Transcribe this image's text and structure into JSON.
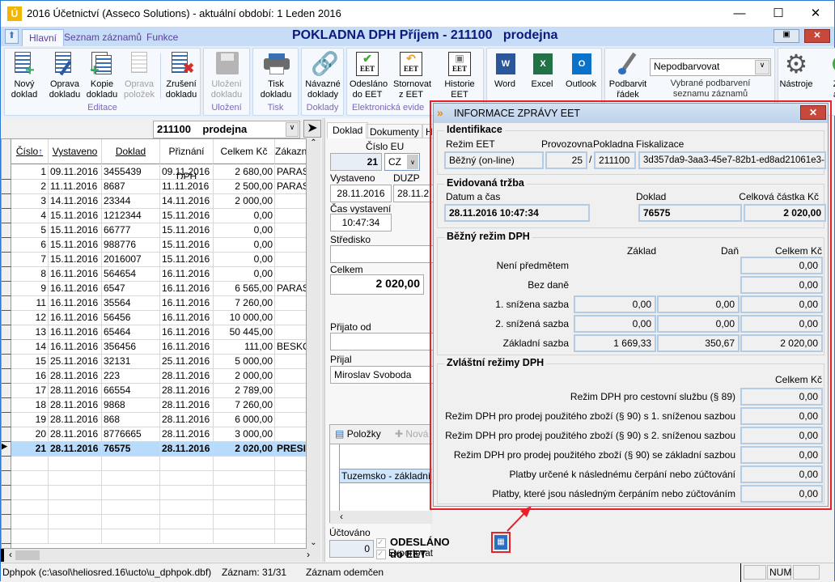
{
  "window": {
    "title": "2016 Účetnictví  (Asseco Solutions)  -  aktuální období:  1  Leden 2016",
    "app_icon_letter": "Ú"
  },
  "ribbon_tabs": [
    "Hlavní",
    "Seznam záznamů",
    "Funkce"
  ],
  "module_title": "POKLADNA DPH Příjem - 211100   prodejna",
  "ribbon": {
    "groups": [
      "Editace",
      "Uložení",
      "Tisk",
      "Doklady",
      "Elektronická evide"
    ],
    "buttons": {
      "novy": [
        "Nový",
        "doklad"
      ],
      "oprava": [
        "Oprava",
        "dokladu"
      ],
      "kopie": [
        "Kopie",
        "dokladu"
      ],
      "oprava_pol": [
        "Oprava",
        "položek"
      ],
      "zruseni": [
        "Zrušení",
        "dokladu"
      ],
      "ulozeni": [
        "Uložení",
        "dokladu"
      ],
      "tisk": [
        "Tisk",
        "dokladu"
      ],
      "navazne": [
        "Návazné",
        "doklady"
      ],
      "odeslano": [
        "Odesláno",
        "do EET"
      ],
      "stornovat": [
        "Stornovat",
        "z EET"
      ],
      "historie": [
        "Historie",
        "EET"
      ],
      "word": "Word",
      "excel": "Excel",
      "outlook": "Outlook",
      "podbarvit": [
        "Podbarvit",
        "řádek"
      ],
      "nastroje": "Nástroje",
      "zo": [
        "Zo",
        "ad"
      ]
    },
    "eet_badge": "EET",
    "color_select": {
      "value": "Nepodbarvovat",
      "caption": [
        "Vybrané podbarvení",
        "seznamu záznamů"
      ]
    }
  },
  "list": {
    "combo_value": "211100    prodejna",
    "columns": [
      "Číslo",
      "Vystaveno",
      "Doklad",
      "Přiznání DPH",
      "Celkem Kč",
      "Zákazní"
    ],
    "rows": [
      [
        "1",
        "09.11.2016",
        "3455439",
        "09.11.2016",
        "2 680,00",
        "PARAS"
      ],
      [
        "2",
        "11.11.2016",
        "8687",
        "11.11.2016",
        "2 500,00",
        "PARAS"
      ],
      [
        "3",
        "14.11.2016",
        "23344",
        "14.11.2016",
        "2 000,00",
        ""
      ],
      [
        "4",
        "15.11.2016",
        "1212344",
        "15.11.2016",
        "0,00",
        ""
      ],
      [
        "5",
        "15.11.2016",
        "66777",
        "15.11.2016",
        "0,00",
        ""
      ],
      [
        "6",
        "15.11.2016",
        "988776",
        "15.11.2016",
        "0,00",
        ""
      ],
      [
        "7",
        "15.11.2016",
        "2016007",
        "15.11.2016",
        "0,00",
        ""
      ],
      [
        "8",
        "16.11.2016",
        "564654",
        "16.11.2016",
        "0,00",
        ""
      ],
      [
        "9",
        "16.11.2016",
        "6547",
        "16.11.2016",
        "6 565,00",
        "PARAS"
      ],
      [
        "11",
        "16.11.2016",
        "35564",
        "16.11.2016",
        "7 260,00",
        ""
      ],
      [
        "12",
        "16.11.2016",
        "56456",
        "16.11.2016",
        "10 000,00",
        ""
      ],
      [
        "13",
        "16.11.2016",
        "65464",
        "16.11.2016",
        "50 445,00",
        ""
      ],
      [
        "14",
        "16.11.2016",
        "356456",
        "16.11.2016",
        "111,00",
        "BESKO"
      ],
      [
        "15",
        "25.11.2016",
        "32131",
        "25.11.2016",
        "5 000,00",
        ""
      ],
      [
        "16",
        "28.11.2016",
        "223",
        "28.11.2016",
        "2 000,00",
        ""
      ],
      [
        "17",
        "28.11.2016",
        "66554",
        "28.11.2016",
        "2 789,00",
        ""
      ],
      [
        "18",
        "28.11.2016",
        "9868",
        "28.11.2016",
        "7 260,00",
        ""
      ],
      [
        "19",
        "28.11.2016",
        "868",
        "28.11.2016",
        "6 000,00",
        ""
      ],
      [
        "20",
        "28.11.2016",
        "8776665",
        "28.11.2016",
        "3 000,00",
        ""
      ],
      [
        "21",
        "28.11.2016",
        "76575",
        "28.11.2016",
        "2 020,00",
        "PRESI"
      ]
    ],
    "selected_row": 19
  },
  "form": {
    "tabs": [
      "Doklad",
      "Dokumenty",
      "H"
    ],
    "cislo_label": "Číslo EU",
    "cislo": "21",
    "eu": "CZ",
    "vystaveno_label": "Vystaveno",
    "vystaveno": "28.11.2016",
    "duzp_label": "DUZP",
    "duzp": "28.11.2",
    "cas_label": "Čas vystavení",
    "cas": "10:47:34",
    "stredisko_label": "Středisko",
    "celkem_label": "Celkem",
    "celkem": "2 020,00",
    "prijato_label": "Přijato od",
    "prijal_label": "Přijal",
    "prijal": "Miroslav Svoboda",
    "polozky_label": "Položky",
    "nova_label": "Nová",
    "polozka_row": "Tuzemsko - základní sa",
    "uctovano_label": "Účtováno",
    "uctovano": "0",
    "odeslano_label": "ODESLÁNO do EET",
    "exportovat_label": "Exportovat"
  },
  "status": {
    "file": "Dphpok (c:\\asol\\heliosred.16\\ucto\\u_dphpok.dbf)",
    "record": "Záznam: 31/31",
    "lock": "Záznam odemčen",
    "num": "NUM"
  },
  "dialog": {
    "title": "INFORMACE ZPRÁVY EET",
    "ident": {
      "legend": "Identifikace",
      "rezim_label": "Režim EET",
      "rezim": "Běžný (on-line)",
      "provozovna_label": "Provozovna",
      "provozovna": "25",
      "sep": "/",
      "pokladna_label": "Pokladna",
      "pokladna": "211100",
      "fisk_label": "Fiskalizace",
      "fisk": "3d357da9-3aa3-45e7-82b1-ed8ad21061e3-ff"
    },
    "trzba": {
      "legend": "Evidovaná tržba",
      "datum_label": "Datum a čas",
      "datum": "28.11.2016 10:47:34",
      "doklad_label": "Doklad",
      "doklad": "76575",
      "castka_label": "Celková částka Kč",
      "castka": "2 020,00"
    },
    "bezny": {
      "legend": "Běžný režim DPH",
      "headers": [
        "Základ",
        "Daň",
        "Celkem Kč"
      ],
      "rows": [
        {
          "label": "Není předmětem",
          "zaklad": null,
          "dan": null,
          "celkem": "0,00"
        },
        {
          "label": "Bez daně",
          "zaklad": null,
          "dan": null,
          "celkem": "0,00"
        },
        {
          "label": "1. snížena sazba",
          "zaklad": "0,00",
          "dan": "0,00",
          "celkem": "0,00"
        },
        {
          "label": "2. snížená sazba",
          "zaklad": "0,00",
          "dan": "0,00",
          "celkem": "0,00"
        },
        {
          "label": "Základní sazba",
          "zaklad": "1 669,33",
          "dan": "350,67",
          "celkem": "2 020,00"
        }
      ]
    },
    "zvlastni": {
      "legend": "Zvláštní režimy DPH",
      "header": "Celkem Kč",
      "rows": [
        {
          "label": "Režim DPH pro cestovní službu (§ 89)",
          "celkem": "0,00"
        },
        {
          "label": "Režim DPH pro prodej použitého zboží (§ 90)  s 1. sníženou sazbou",
          "celkem": "0,00"
        },
        {
          "label": "Režim DPH pro prodej použitého zboží (§ 90) s 2. sníženou sazbou",
          "celkem": "0,00"
        },
        {
          "label": "Režim DPH pro prodej použitého zboží (§ 90) se základní sazbou",
          "celkem": "0,00"
        },
        {
          "label": "Platby určené k následnému čerpání nebo zúčtování",
          "celkem": "0,00"
        },
        {
          "label": "Platby, které jsou následným čerpáním nebo zúčtováním",
          "celkem": "0,00"
        }
      ]
    }
  },
  "colors": {
    "highlight": "#e8202a",
    "selection": "#b9dbfb",
    "title_navy": "#0b1a7a"
  }
}
